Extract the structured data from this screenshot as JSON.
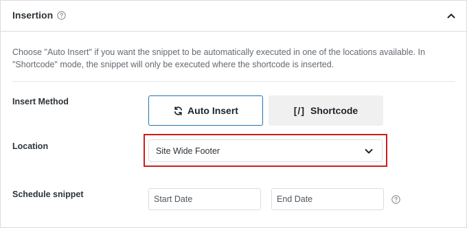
{
  "header": {
    "title": "Insertion",
    "help_icon": "question-circle-icon",
    "collapse_icon": "chevron-up-icon"
  },
  "description": "Choose \"Auto Insert\" if you want the snippet to be automatically executed in one of the locations available. In \"Shortcode\" mode, the snippet will only be executed where the shortcode is inserted.",
  "insert_method": {
    "label": "Insert Method",
    "options": [
      {
        "label": "Auto Insert",
        "icon": "sync-icon",
        "selected": true
      },
      {
        "label": "Shortcode",
        "icon_text": "[/]",
        "selected": false
      }
    ]
  },
  "location": {
    "label": "Location",
    "selected": "Site Wide Footer",
    "highlight_color": "#d11a1a"
  },
  "schedule": {
    "label": "Schedule snippet",
    "start_placeholder": "Start Date",
    "end_placeholder": "End Date"
  },
  "colors": {
    "accent": "#2271b1",
    "highlight": "#d11a1a"
  }
}
